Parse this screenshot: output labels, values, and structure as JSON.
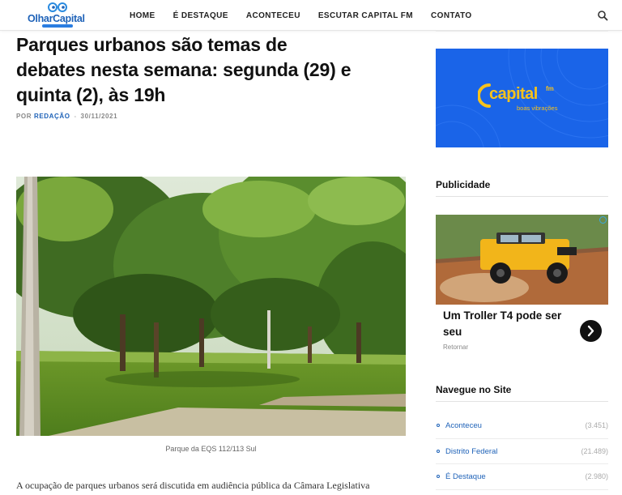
{
  "header": {
    "logo_text": "OlharCapital",
    "nav": [
      "HOME",
      "É DESTAQUE",
      "ACONTECEU",
      "ESCUTAR CAPITAL FM",
      "CONTATO"
    ]
  },
  "article": {
    "title": "Parques urbanos são temas de debates nesta semana: segunda (29) e quinta (2), às 19h",
    "by": "POR",
    "author": "REDAÇÃO",
    "separator": "-",
    "date": "30/11/2021",
    "caption": "Parque da EQS 112/113 Sul",
    "body_start": "A ocupação de parques urbanos será discutida em audiência pública da Câmara Legislativa"
  },
  "sidebar": {
    "banner": {
      "brand": "capital",
      "fm": "fm",
      "slogan": "boas vibrações"
    },
    "publicidade_title": "Publicidade",
    "ad": {
      "headline": "Um Troller T4 pode ser seu",
      "source": "Retornar"
    },
    "navegue_title": "Navegue no Site",
    "categories": [
      {
        "label": "Aconteceu",
        "count": "(3.451)"
      },
      {
        "label": "Distrito Federal",
        "count": "(21.489)"
      },
      {
        "label": "É Destaque",
        "count": "(2.980)"
      }
    ]
  },
  "colors": {
    "brand_blue": "#1e62b8",
    "banner_blue": "#1a64e8",
    "banner_yellow": "#f7c21b"
  }
}
